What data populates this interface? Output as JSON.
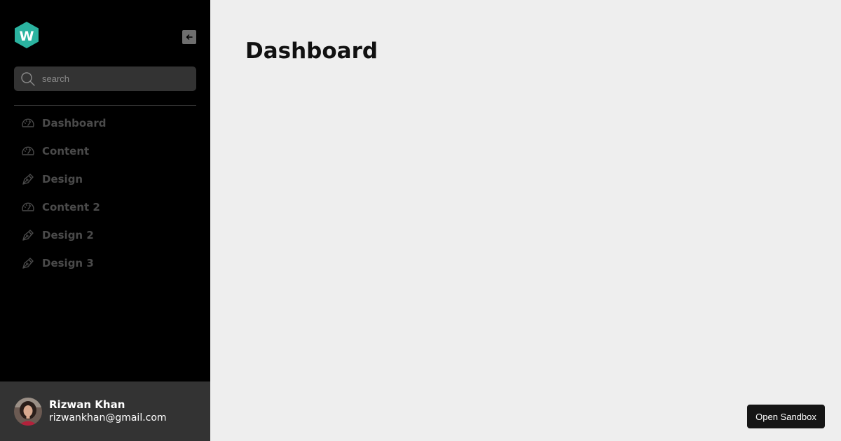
{
  "brand": {
    "logo_letter": "W",
    "logo_color": "#2bb3a0"
  },
  "sidebar": {
    "collapse_icon": "arrow-left-icon",
    "search": {
      "icon": "search-icon",
      "placeholder": "search",
      "value": ""
    },
    "items": [
      {
        "label": "Dashboard",
        "icon": "speedometer-icon"
      },
      {
        "label": "Content",
        "icon": "speedometer-icon"
      },
      {
        "label": "Design",
        "icon": "pen-nib-icon"
      },
      {
        "label": "Content 2",
        "icon": "speedometer-icon"
      },
      {
        "label": "Design 2",
        "icon": "pen-nib-icon"
      },
      {
        "label": "Design 3",
        "icon": "pen-nib-icon"
      }
    ]
  },
  "user": {
    "name": "Rizwan Khan",
    "email": "rizwankhan@gmail.com"
  },
  "main": {
    "title": "Dashboard"
  },
  "sandbox": {
    "label": "Open Sandbox"
  }
}
